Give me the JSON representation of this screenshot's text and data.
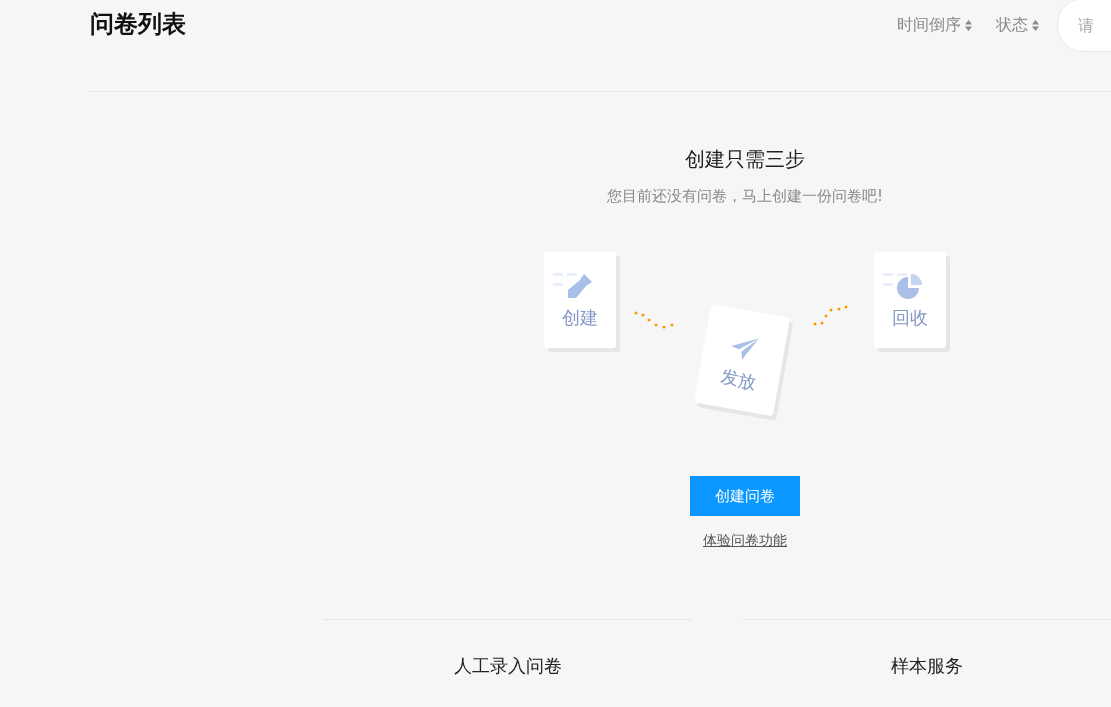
{
  "header": {
    "title": "问卷列表",
    "sorts": [
      {
        "label": "时间倒序"
      },
      {
        "label": "状态"
      }
    ],
    "search": {
      "placeholder": "请"
    }
  },
  "empty": {
    "title": "创建只需三步",
    "subtitle": "您目前还没有问卷，马上创建一份问卷吧!",
    "steps": [
      {
        "kind": "pen",
        "label": "创建"
      },
      {
        "kind": "plane",
        "label": "发放"
      },
      {
        "kind": "pie",
        "label": "回收"
      }
    ],
    "create_button": "创建问卷",
    "demo_link": "体验问卷功能"
  },
  "sections": [
    {
      "title": "人工录入问卷"
    },
    {
      "title": "样本服务"
    }
  ]
}
